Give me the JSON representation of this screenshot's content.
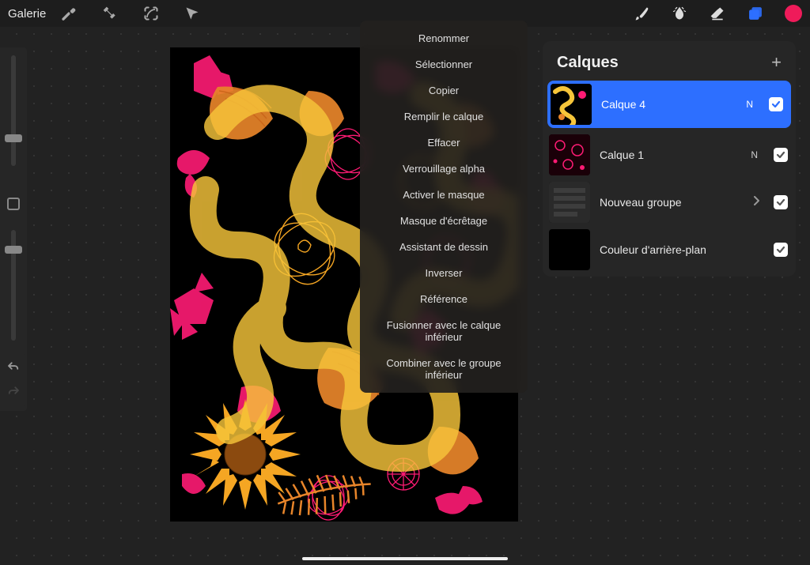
{
  "topbar": {
    "gallery_label": "Galerie",
    "icons": {
      "wrench": "wrench-icon",
      "wand": "adjustments-icon",
      "selection": "selection-icon",
      "move": "move-icon",
      "brush": "brush-icon",
      "smudge": "smudge-icon",
      "eraser": "eraser-icon",
      "layers": "layers-icon",
      "color": "color-swatch"
    },
    "current_color": "#ef1b5a"
  },
  "left_rail": {
    "size_slider_value": 0.75,
    "opacity_slider_value": 0.82
  },
  "context_menu": {
    "items": [
      "Renommer",
      "Sélectionner",
      "Copier",
      "Remplir le calque",
      "Effacer",
      "Verrouillage alpha",
      "Activer le masque",
      "Masque d'écrêtage",
      "Assistant de dessin",
      "Inverser",
      "Référence",
      "Fusionner avec le calque inférieur",
      "Combiner avec le groupe inférieur"
    ]
  },
  "layers_panel": {
    "title": "Calques",
    "layers": [
      {
        "label": "Calque 4",
        "blend": "N",
        "visible": true,
        "selected": true,
        "type": "layer"
      },
      {
        "label": "Calque 1",
        "blend": "N",
        "visible": true,
        "selected": false,
        "type": "layer"
      },
      {
        "label": "Nouveau groupe",
        "blend": "",
        "visible": true,
        "selected": false,
        "type": "group"
      },
      {
        "label": "Couleur d'arrière-plan",
        "blend": "",
        "visible": true,
        "selected": false,
        "type": "background",
        "bg_color": "#000000"
      }
    ]
  },
  "colors": {
    "accent_blue": "#2d6fff",
    "accent_pink": "#ff1b74",
    "accent_orange": "#f5a623",
    "accent_yellow": "#f6c53a",
    "panel_bg": "#262626",
    "app_bg": "#1a1a1a"
  }
}
